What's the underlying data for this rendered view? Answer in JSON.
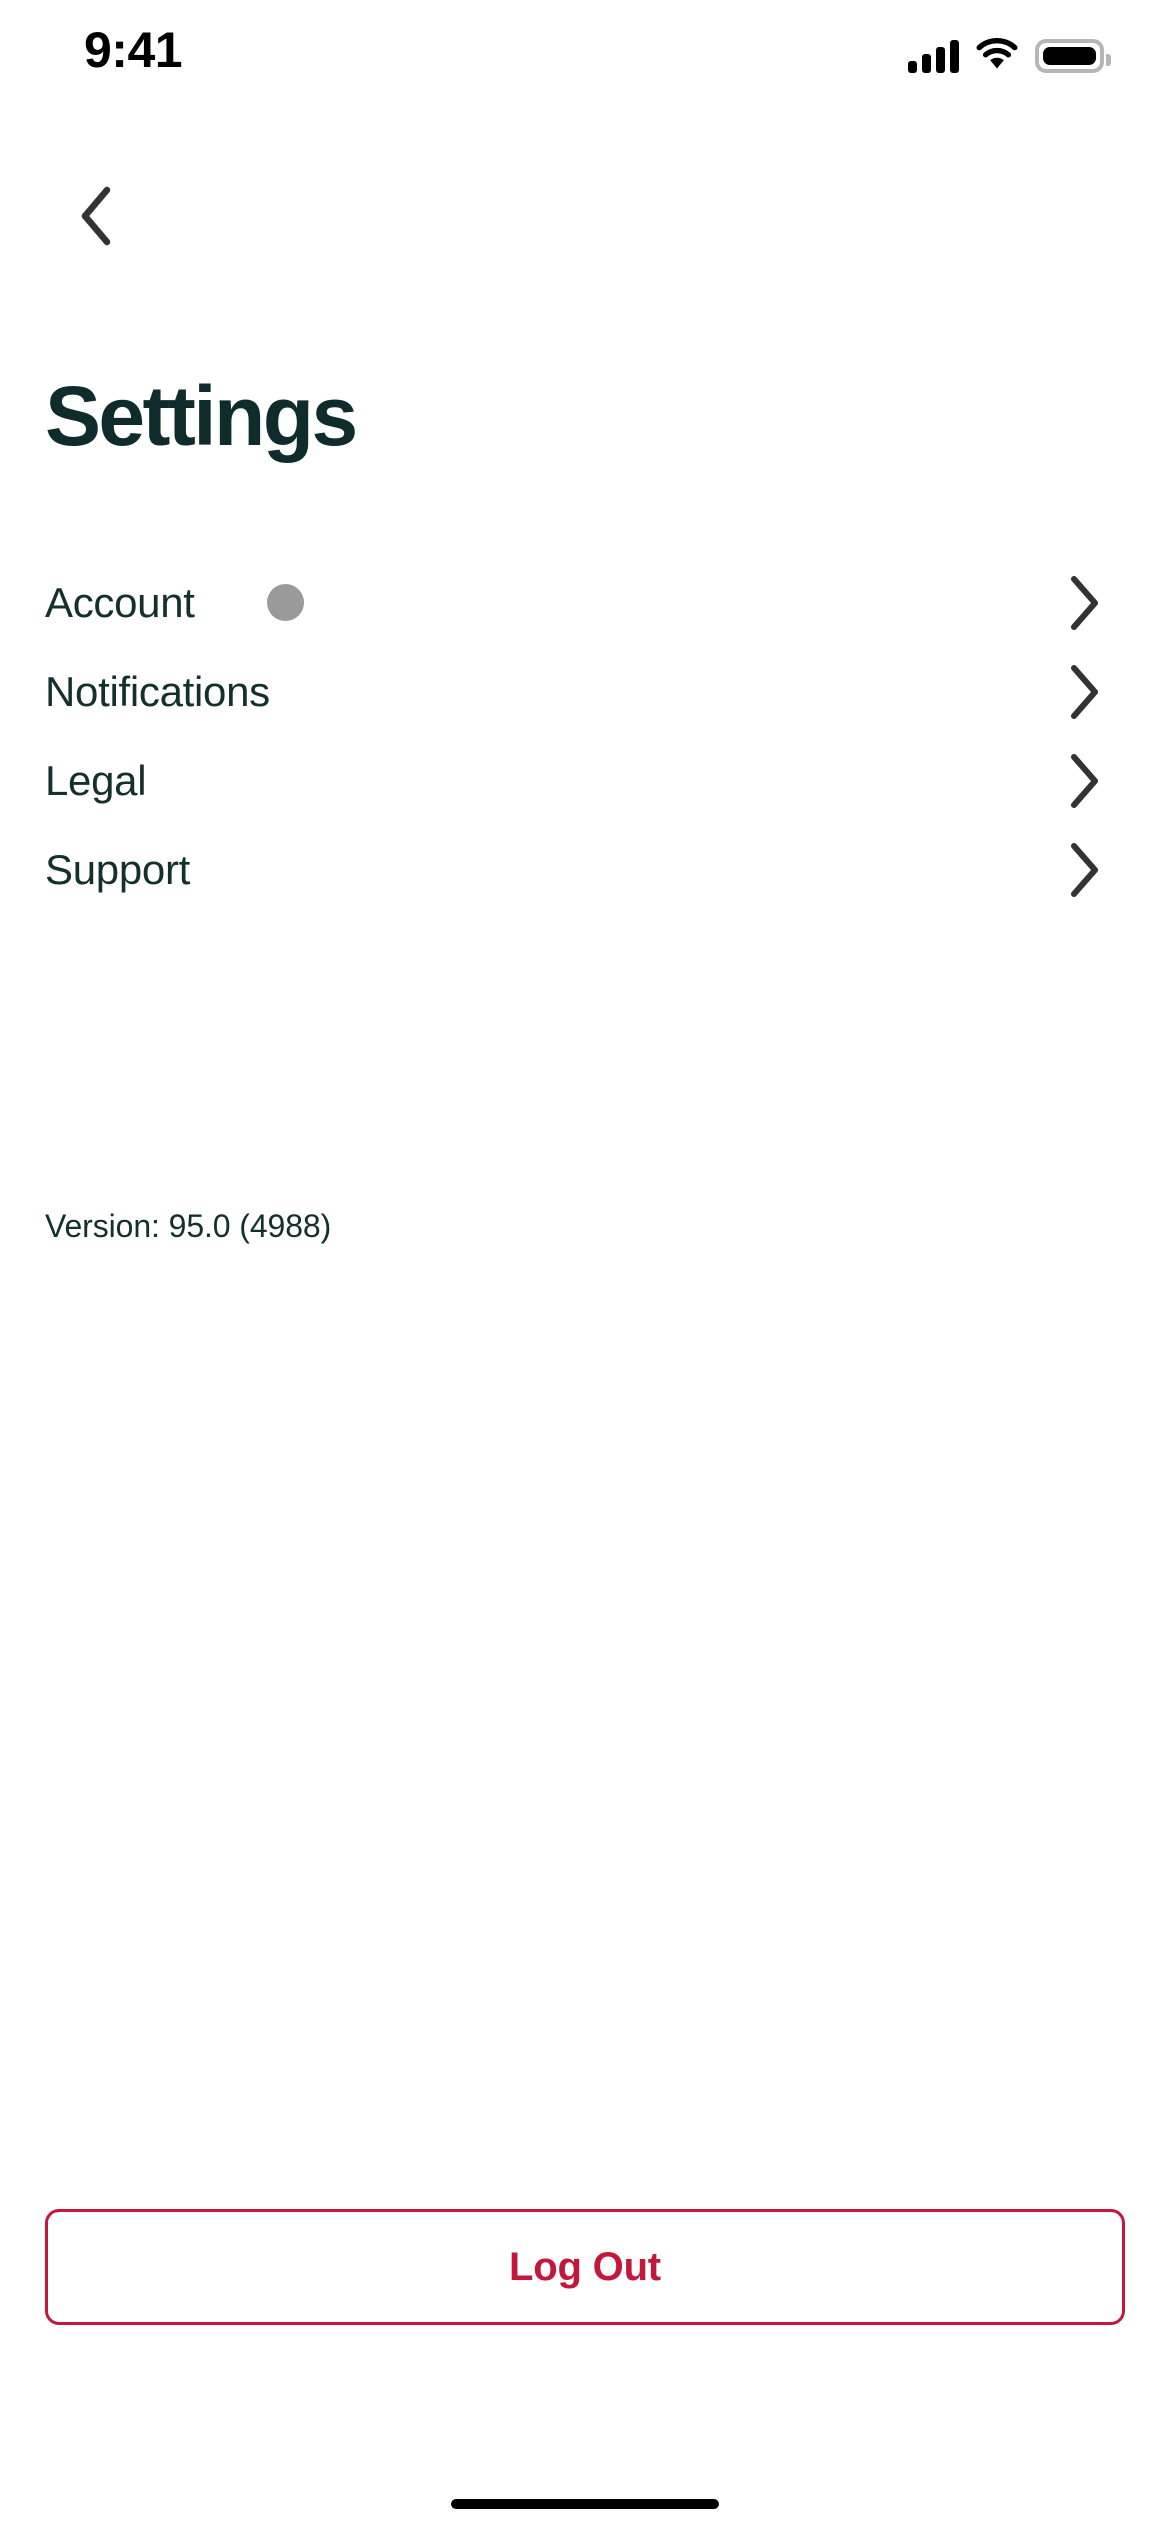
{
  "status_bar": {
    "time": "9:41",
    "cellular_icon": "cellular-signal-icon",
    "cellular_bars_filled": 4,
    "cellular_bars_total": 4,
    "wifi_icon": "wifi-icon",
    "wifi_level": "full",
    "battery_icon": "battery-icon",
    "battery_level_percent": 100
  },
  "nav": {
    "back_icon": "chevron-left-icon",
    "back_label": "Back"
  },
  "header": {
    "title": "Settings"
  },
  "menu": {
    "items": [
      {
        "label": "Account",
        "has_badge": true,
        "badge_icon": "avatar-placeholder-icon",
        "chevron_icon": "chevron-right-icon"
      },
      {
        "label": "Notifications",
        "has_badge": false,
        "chevron_icon": "chevron-right-icon"
      },
      {
        "label": "Legal",
        "has_badge": false,
        "chevron_icon": "chevron-right-icon"
      },
      {
        "label": "Support",
        "has_badge": false,
        "chevron_icon": "chevron-right-icon"
      }
    ]
  },
  "version": {
    "text": "Version: 95.0 (4988)"
  },
  "logout": {
    "label": "Log Out"
  },
  "colors": {
    "title_text": "#0f2b2b",
    "menu_text": "#14302e",
    "chevron": "#333333",
    "badge_gray": "#9a9a9a",
    "danger": "#c3173c",
    "background": "#ffffff"
  }
}
